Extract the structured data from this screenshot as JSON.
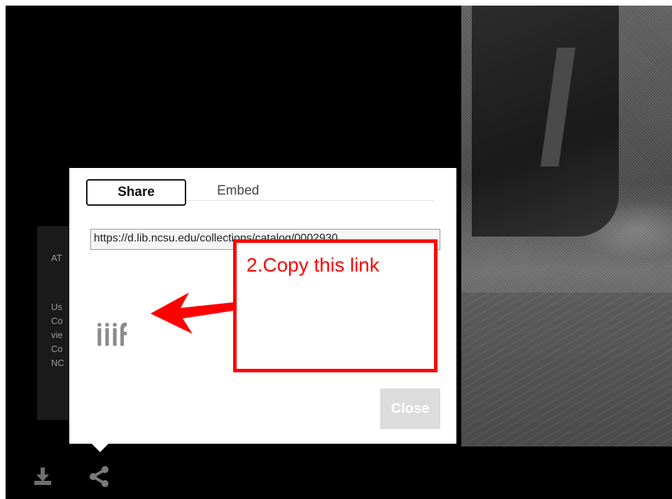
{
  "popup": {
    "tabs": [
      {
        "label": "Share",
        "active": true
      },
      {
        "label": "Embed",
        "active": false
      }
    ],
    "link_value": "https://d.lib.ncsu.edu/collections/catalog/0002930",
    "iiif_logo_text": "iiif",
    "close_label": "Close"
  },
  "annotation": {
    "text": "2.Copy this link",
    "color": "#ff0000"
  },
  "info_panel": {
    "lines": [
      "AT",
      "Us",
      "Co",
      "vie",
      "Co",
      "NC"
    ]
  },
  "toolbar": {
    "icons": [
      "download-icon",
      "share-icon"
    ]
  }
}
